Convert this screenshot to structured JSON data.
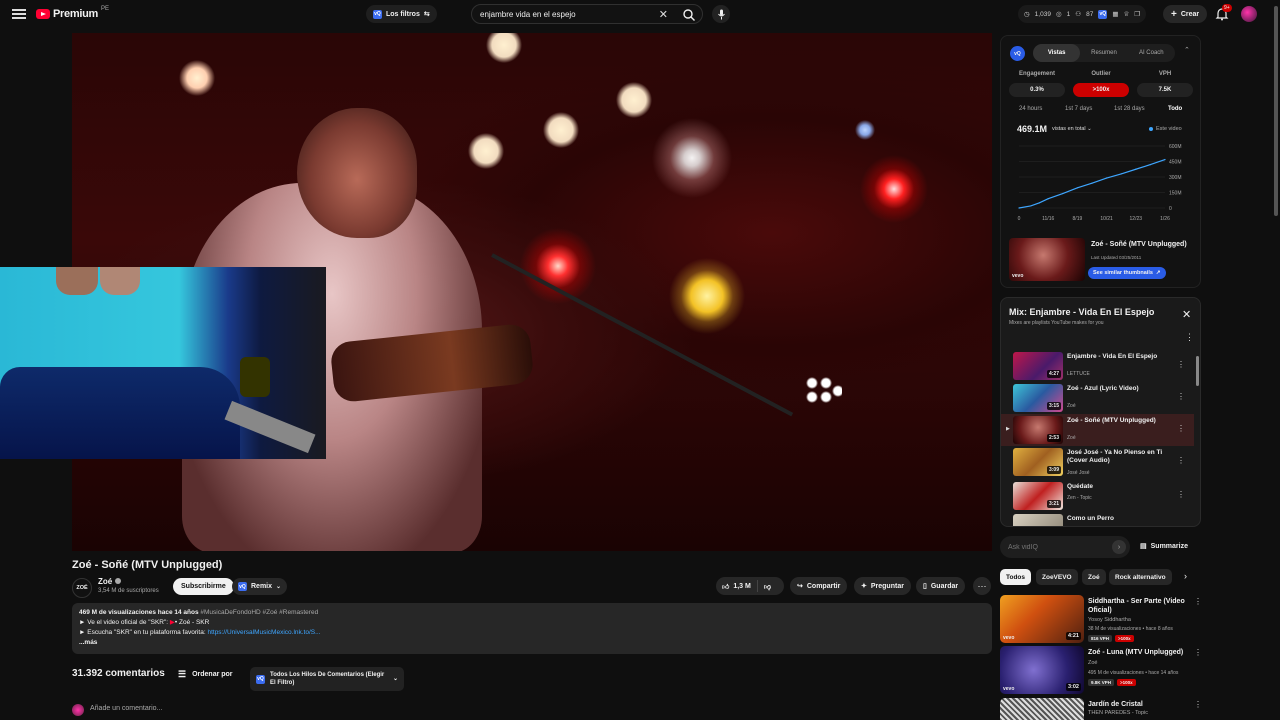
{
  "header": {
    "logo_text": "Premium",
    "logo_region": "PE",
    "filters_label": "Los filtros",
    "filters_badge": "vQ",
    "search_value": "enjambre vida en el espejo",
    "stats": [
      "1,039",
      "1",
      "87"
    ],
    "create_label": "Crear",
    "notifications_badge": "9+"
  },
  "video": {
    "title": "Zoé - Soñé (MTV Unplugged)",
    "channel_avatar_text": "ZOÉ",
    "channel_name": "Zoé",
    "subscribers": "3,54 M de suscriptores",
    "subscribe_label": "Subscribirme",
    "remix_label": "Remix",
    "likes": "1,3 M",
    "share_label": "Compartir",
    "ask_label": "Preguntar",
    "save_label": "Guardar",
    "more_label": "⋯"
  },
  "description": {
    "meta": "469 M de visualizaciones  hace 14 años",
    "tags": "#MusicaDeFondoHD #Zoé #Remastered",
    "line1_prefix": "► Ve el video oficial de \"SKR\": ",
    "line1_link": "• Zoé - SKR",
    "line2_prefix": "► Escucha \"SKR\" en tu plataforma favorita: ",
    "line2_link": "https://UniversalMusicMexico.lnk.to/S...",
    "more": "...más"
  },
  "comments": {
    "count": "31.392 comentarios",
    "sort_label": "Ordenar por",
    "filter_label": "Todos Los Hilos De Comentarios (Elegir El Filtro)",
    "add_placeholder": "Añade un comentario..."
  },
  "vidiq": {
    "logo": "vQ",
    "tabs": [
      "Vistas",
      "Resumen",
      "AI Coach"
    ],
    "active_tab": 0,
    "metrics": [
      {
        "label": "Engagement",
        "value": "0.3%"
      },
      {
        "label": "Outlier",
        "value": ">100x"
      },
      {
        "label": "VPH",
        "value": "7.5K"
      }
    ],
    "ranges": [
      "24 hours",
      "1st 7 days",
      "1st 28 days",
      "Todo"
    ],
    "active_range": 3,
    "total_views": "469.1M",
    "views_selector": "vistas en total",
    "legend": "Este video",
    "similar": {
      "vevo": "vevo",
      "title": "Zoé - Soñé (MTV Unplugged)",
      "updated": "Last Updated 03/25/2011",
      "button": "See similar thumbnails"
    }
  },
  "chart_data": {
    "type": "line",
    "x_ticks": [
      "0",
      "11/16",
      "8/19",
      "10/21",
      "12/23",
      "1/26"
    ],
    "y_ticks": [
      "0",
      "150M",
      "300M",
      "450M",
      "600M"
    ],
    "ylim": [
      0,
      600
    ],
    "series": [
      {
        "name": "Este video",
        "x": [
          0,
          0.4,
          0.7,
          1.0,
          1.5,
          2.0,
          2.5,
          3.0,
          3.5,
          4.0,
          4.5,
          5.0
        ],
        "values": [
          0,
          20,
          50,
          90,
          140,
          195,
          240,
          290,
          330,
          375,
          420,
          469
        ]
      }
    ]
  },
  "mix": {
    "title": "Mix: Enjambre - Vida En El Espejo",
    "subtitle": "Mixes are playlists YouTube makes for you",
    "items": [
      {
        "title": "Enjambre - Vida En El Espejo",
        "channel": "LETTUCE",
        "duration": "4:27"
      },
      {
        "title": "Zoé - Azul (Lyric Video)",
        "channel": "Zoé",
        "duration": "3:15"
      },
      {
        "title": "Zoé - Soñé (MTV Unplugged)",
        "channel": "Zoé",
        "duration": "2:53"
      },
      {
        "title": "José José - Ya No Pienso en Ti (Cover Audio)",
        "channel": "José José",
        "duration": "3:09"
      },
      {
        "title": "Quédate",
        "channel": "Zen - Topic",
        "duration": "3:21"
      },
      {
        "title": "Como un Perro",
        "channel": "",
        "duration": ""
      }
    ]
  },
  "ask": {
    "placeholder": "Ask vidIQ",
    "summarize_label": "Summarize"
  },
  "chips": [
    "Todos",
    "ZoeVEVO",
    "Zoé",
    "Rock alternativo"
  ],
  "recommendations": [
    {
      "title": "Siddhartha - Ser Parte (Video Oficial)",
      "channel": "Yosoy Siddhartha",
      "views": "38 M de visualizaciones • hace 8 años",
      "vph": "816 VPH",
      "outlier": ">100x",
      "duration": "4:21",
      "vevo": "vevo"
    },
    {
      "title": "Zoé - Luna (MTV Unplugged)",
      "channel": "Zoé",
      "views": "495 M de visualizaciones • hace 14 años",
      "vph": "9.8K VPH",
      "outlier": ">100x",
      "duration": "3:02",
      "vevo": "vevo"
    },
    {
      "title": "Jardín de Cristal",
      "channel": "THEN PAREDES - Topic",
      "views": "",
      "vph": "",
      "outlier": "",
      "duration": "",
      "vevo": ""
    }
  ]
}
